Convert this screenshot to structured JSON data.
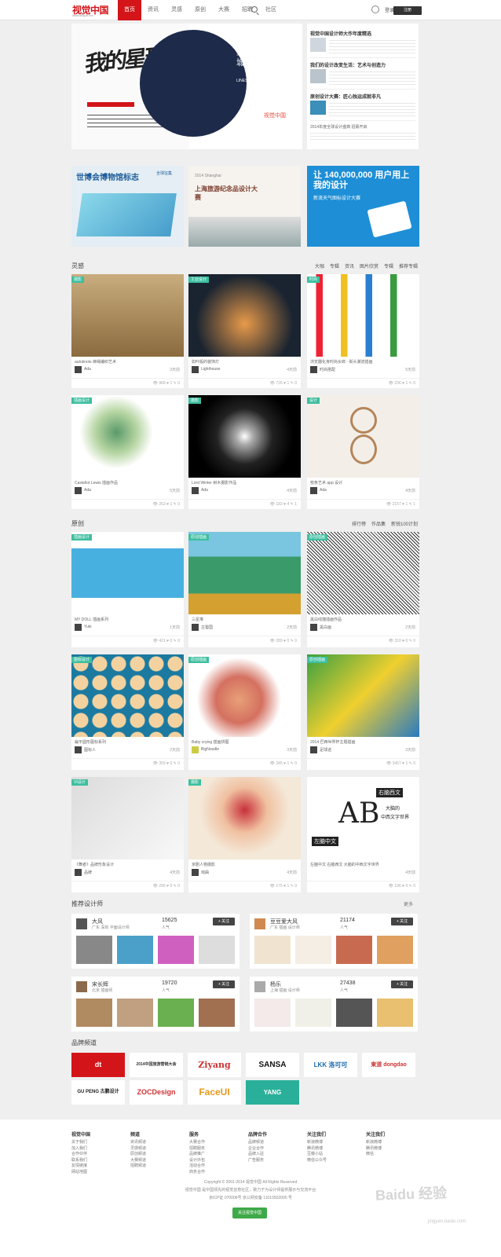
{
  "header": {
    "logo": "视觉中国",
    "logo_sub": "www.shijue.me",
    "nav": [
      "首页",
      "资讯",
      "灵感",
      "原创",
      "大赛",
      "招聘",
      "社区"
    ],
    "login": "登录",
    "signup": "注册"
  },
  "banner": {
    "left_art": "我的星球",
    "right_title": "线络迷城",
    "right_sub_en": "LINES",
    "right_caption": "视觉中国"
  },
  "news": [
    {
      "title": "视觉中国设计师大作年度精选"
    },
    {
      "title": "我们的设计改变生活：艺术与创造力"
    },
    {
      "title": "原创设计大赛：匠心独运成就非凡"
    },
    {
      "title": "2014年度全球设计盛典 招募开启"
    }
  ],
  "ads": [
    {
      "title": "世博会博物馆标志",
      "sub": "全球征集"
    },
    {
      "title": "上海旅游纪念品设计大赛",
      "sub": "2014 Shanghai"
    },
    {
      "title": "让 140,000,000 用户用上我的设计",
      "sub": "新浪天气图标设计大赛"
    }
  ],
  "inspiration": {
    "title": "灵感",
    "tabs": [
      "大咖",
      "专辑",
      "资讯",
      "图片欣赏",
      "专辑",
      "推荐专辑"
    ],
    "cards": [
      {
        "tag": "摄影",
        "title": "autoknots 麻绳编织艺术",
        "author": "Ada",
        "time": "3天前",
        "stats": "👁 968  ♥ 1  ✎ 0"
      },
      {
        "tag": "工业设计",
        "title": "如叶般的装饰灯",
        "author": "Lighthouse",
        "time": "4天前",
        "stats": "👁 726  ♥ 1  ✎ 0"
      },
      {
        "tag": "时尚",
        "title": "浏览器化身时尚女郎 - 街头潮流插画",
        "author": "时尚搭配",
        "time": "5天前",
        "stats": "👁 236  ♥ 1  ✎ 0"
      },
      {
        "tag": "插画设计",
        "title": "Casteliot Lewis 插画作品",
        "author": "Ada",
        "time": "5天前",
        "stats": "👁 263  ♥ 1  ✎ 0"
      },
      {
        "tag": "摄影",
        "title": "Lord Winter 树木摄影作品",
        "author": "Ada",
        "time": "4天前",
        "stats": "👁 183  ♥ 4  ✎ 1"
      },
      {
        "tag": "设计",
        "title": "枝条艺术 app 设计",
        "author": "Ada",
        "time": "4天前",
        "stats": "👁 2157  ♥ 1  ✎ 1"
      }
    ]
  },
  "original": {
    "title": "原创",
    "tabs": [
      "排行榜",
      "作品集",
      "新锐100计划"
    ],
    "cards": [
      {
        "tag": "插画设计",
        "title": "MY DOLL 插画系列",
        "author": "Yuki",
        "time": "1天前",
        "stats": "👁 421  ♥ 0  ✎ 0"
      },
      {
        "tag": "原创插画",
        "title": "三星堆",
        "author": "古蜀国",
        "time": "2天前",
        "stats": "👁 289  ♥ 0  ✎ 0"
      },
      {
        "tag": "原创插画",
        "title": "黑白线描插画作品",
        "author": "黑白画",
        "time": "2天前",
        "stats": "👁 310  ♥ 0  ✎ 0"
      },
      {
        "tag": "图标设计",
        "title": "扁平圆形图标系列",
        "author": "图标人",
        "time": "2天前",
        "stats": "👁 359  ♥ 0  ✎ 0"
      },
      {
        "tag": "原创插画",
        "title": "Baby crying 插画拼图",
        "author": "BigNoodle",
        "time": "3天前",
        "stats": "👁 345  ♥ 1  ✎ 0"
      },
      {
        "tag": "原创插画",
        "title": "2014 巴西世界杯主题插画",
        "author": "足球迷",
        "time": "3天前",
        "stats": "👁 3457  ♥ 1  ✎ 0"
      },
      {
        "tag": "VI设计",
        "title": "《舞者》品牌形象设计",
        "author": "品牌",
        "time": "4天前",
        "stats": "👁 295  ♥ 0  ✎ 0"
      },
      {
        "tag": "摄影",
        "title": "京剧人物摄影",
        "author": "戏曲",
        "time": "4天前",
        "stats": "👁 175  ♥ 1  ✎ 0"
      },
      {
        "tag": "字体设计",
        "title": "左脑中文 右脑西文 大脑的中西文字世界",
        "author": "字体",
        "time": "4天前",
        "stats": "👁 196  ♥ 0  ✎ 0"
      }
    ],
    "card9_text": {
      "a": "右脑西文",
      "b": "大脑的",
      "c": "中西文字世界",
      "d": "左脑中文",
      "big": "AB"
    }
  },
  "designers": {
    "title": "推荐设计师",
    "more": "更多",
    "list": [
      {
        "name": "大风",
        "desc": "广东 深圳 平面设计师",
        "num": "15625",
        "pop": "人气",
        "follow": "+ 关注"
      },
      {
        "name": "豆豆爱大风",
        "desc": "广东 插画 设计师",
        "num": "21174",
        "pop": "人气",
        "follow": "+ 关注"
      },
      {
        "name": "宋长辉",
        "desc": "北京 插画师",
        "num": "19720",
        "pop": "人气",
        "follow": "+ 关注"
      },
      {
        "name": "杨乐",
        "desc": "上海 插画 设计师",
        "num": "27438",
        "pop": "人气",
        "follow": "+ 关注"
      }
    ]
  },
  "brands": {
    "title": "品牌频道",
    "list": [
      "dt",
      "2014中国旅游营销大会",
      "Ziyang",
      "SANSA",
      "LKK 洛可可",
      "東道 dongdao",
      "GU PENG 古鹏设计",
      "ZOCDesign",
      "FaceUI",
      "YANG"
    ]
  },
  "footer": {
    "cols": [
      {
        "head": "视觉中国",
        "links": [
          "关于我们",
          "加入我们",
          "合作伙伴",
          "联系我们",
          "友情链接",
          "网站地图"
        ]
      },
      {
        "head": "频道",
        "links": [
          "资讯频道",
          "灵感频道",
          "原创频道",
          "大赛频道",
          "招聘频道"
        ]
      },
      {
        "head": "服务",
        "links": [
          "大赛合作",
          "招聘服务",
          "品牌推广",
          "设计外包",
          "活动合作",
          "商务合作"
        ]
      },
      {
        "head": "品牌合作",
        "links": [
          "品牌频道",
          "企业合作",
          "品牌入驻",
          "广告服务"
        ]
      },
      {
        "head": "关注我们",
        "links": [
          "新浪微博",
          "腾讯微博",
          "豆瓣小站",
          "微信公众号"
        ]
      },
      {
        "head": "关注我们",
        "links": [
          "新浪微博",
          "腾讯微博",
          "微信"
        ]
      }
    ],
    "copyright": "Copyright © 2001-2014 视觉中国 All Rights Reserved",
    "line2": "视觉中国 是中国领先的视觉创意社区，致力于为设计师提供展示与交流平台",
    "line3": "京ICP证 070006号  京公网安备 11010502000 号",
    "wechat": "关注视觉中国"
  },
  "watermark": {
    "main": "Baidu 经验",
    "sub": "jingyan.baidu.com"
  },
  "colors": {
    "brand": "#d3151a",
    "tag": "#3dbfa0"
  }
}
